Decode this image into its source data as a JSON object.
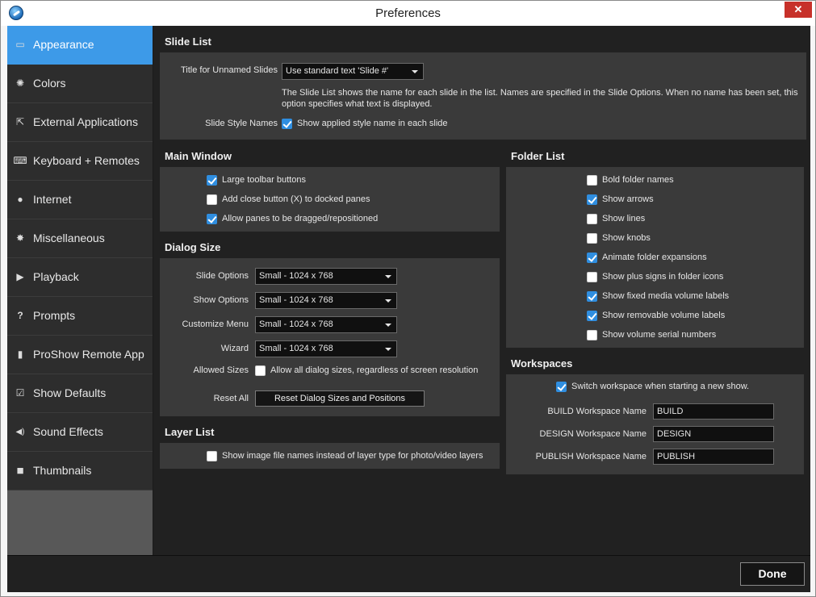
{
  "window": {
    "title": "Preferences",
    "close_label": "✕"
  },
  "sidebar": {
    "items": [
      {
        "label": "Appearance",
        "icon": "appearance-icon",
        "glyph": "▭"
      },
      {
        "label": "Colors",
        "icon": "colors-icon",
        "glyph": "✺"
      },
      {
        "label": "External Applications",
        "icon": "external-apps-icon",
        "glyph": "⇱"
      },
      {
        "label": "Keyboard + Remotes",
        "icon": "keyboard-icon",
        "glyph": "⌨"
      },
      {
        "label": "Internet",
        "icon": "internet-icon",
        "glyph": "●"
      },
      {
        "label": "Miscellaneous",
        "icon": "gear-icon",
        "glyph": "✸"
      },
      {
        "label": "Playback",
        "icon": "play-icon",
        "glyph": "▶"
      },
      {
        "label": "Prompts",
        "icon": "question-icon",
        "glyph": "?"
      },
      {
        "label": "ProShow Remote App",
        "icon": "remote-icon",
        "glyph": "▮"
      },
      {
        "label": "Show Defaults",
        "icon": "checkmark-icon",
        "glyph": "☑"
      },
      {
        "label": "Sound Effects",
        "icon": "speaker-icon",
        "glyph": "◀)"
      },
      {
        "label": "Thumbnails",
        "icon": "thumbnails-icon",
        "glyph": "■"
      }
    ]
  },
  "slide_list": {
    "header": "Slide List",
    "title_label": "Title for Unnamed Slides",
    "title_value": "Use standard text 'Slide #'",
    "description": "The Slide List shows the name for each slide in the list. Names are specified in the Slide Options. When no name has been set, this option specifies what text is displayed.",
    "style_names_label": "Slide Style Names",
    "style_names_checkbox": "Show applied style name in each slide"
  },
  "main_window": {
    "header": "Main Window",
    "options": [
      {
        "label": "Large toolbar buttons",
        "checked": true
      },
      {
        "label": "Add close button (X) to docked panes",
        "checked": false
      },
      {
        "label": "Allow panes to be dragged/repositioned",
        "checked": true
      }
    ]
  },
  "dialog_size": {
    "header": "Dialog Size",
    "rows": [
      {
        "label": "Slide Options",
        "value": "Small - 1024 x 768"
      },
      {
        "label": "Show Options",
        "value": "Small - 1024 x 768"
      },
      {
        "label": "Customize Menu",
        "value": "Small - 1024 x 768"
      },
      {
        "label": "Wizard",
        "value": "Small - 1024 x 768"
      }
    ],
    "allowed_label": "Allowed Sizes",
    "allowed_checkbox": "Allow all dialog sizes, regardless of screen resolution",
    "reset_label": "Reset All",
    "reset_button": "Reset Dialog Sizes and Positions"
  },
  "layer_list": {
    "header": "Layer List",
    "checkbox": "Show image file names instead of layer type for photo/video layers"
  },
  "folder_list": {
    "header": "Folder List",
    "options": [
      {
        "label": "Bold folder names",
        "checked": false
      },
      {
        "label": "Show arrows",
        "checked": true
      },
      {
        "label": "Show lines",
        "checked": false
      },
      {
        "label": "Show knobs",
        "checked": false
      },
      {
        "label": "Animate folder expansions",
        "checked": true
      },
      {
        "label": "Show plus signs in folder icons",
        "checked": false
      },
      {
        "label": "Show fixed media volume labels",
        "checked": true
      },
      {
        "label": "Show removable volume labels",
        "checked": true
      },
      {
        "label": "Show volume serial numbers",
        "checked": false
      }
    ]
  },
  "workspaces": {
    "header": "Workspaces",
    "switch_checkbox": "Switch workspace when starting a new show.",
    "fields": [
      {
        "label": "BUILD Workspace Name",
        "value": "BUILD"
      },
      {
        "label": "DESIGN Workspace Name",
        "value": "DESIGN"
      },
      {
        "label": "PUBLISH Workspace Name",
        "value": "PUBLISH"
      }
    ]
  },
  "footer": {
    "done_label": "Done"
  }
}
